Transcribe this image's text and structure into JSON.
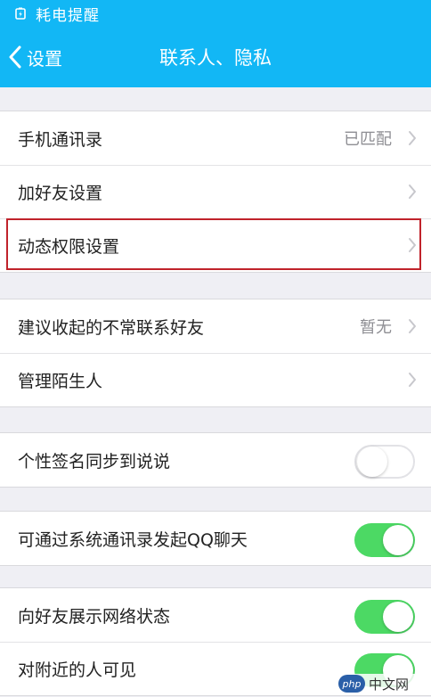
{
  "colors": {
    "accent": "#12b7f5",
    "toggle_on": "#4cd964",
    "highlight": "#c0232b"
  },
  "status_bar": {
    "icon": "battery-saver-icon",
    "text": "耗电提醒"
  },
  "nav": {
    "back_label": "设置",
    "title": "联系人、隐私"
  },
  "groups": [
    {
      "rows": [
        {
          "label": "手机通讯录",
          "value": "已匹配",
          "chevron": true
        },
        {
          "label": "加好友设置",
          "chevron": true
        },
        {
          "label": "动态权限设置",
          "chevron": true,
          "highlighted": true
        }
      ]
    },
    {
      "rows": [
        {
          "label": "建议收起的不常联系好友",
          "value": "暂无",
          "chevron": true
        },
        {
          "label": "管理陌生人",
          "chevron": true
        }
      ]
    },
    {
      "rows": [
        {
          "label": "个性签名同步到说说",
          "toggle": false
        }
      ]
    },
    {
      "rows": [
        {
          "label": "可通过系统通讯录发起QQ聊天",
          "toggle": true
        }
      ]
    },
    {
      "rows": [
        {
          "label": "向好友展示网络状态",
          "toggle": true
        },
        {
          "label": "对附近的人可见",
          "toggle": true
        }
      ]
    }
  ],
  "watermark": {
    "logo": "php",
    "text": "中文网"
  }
}
